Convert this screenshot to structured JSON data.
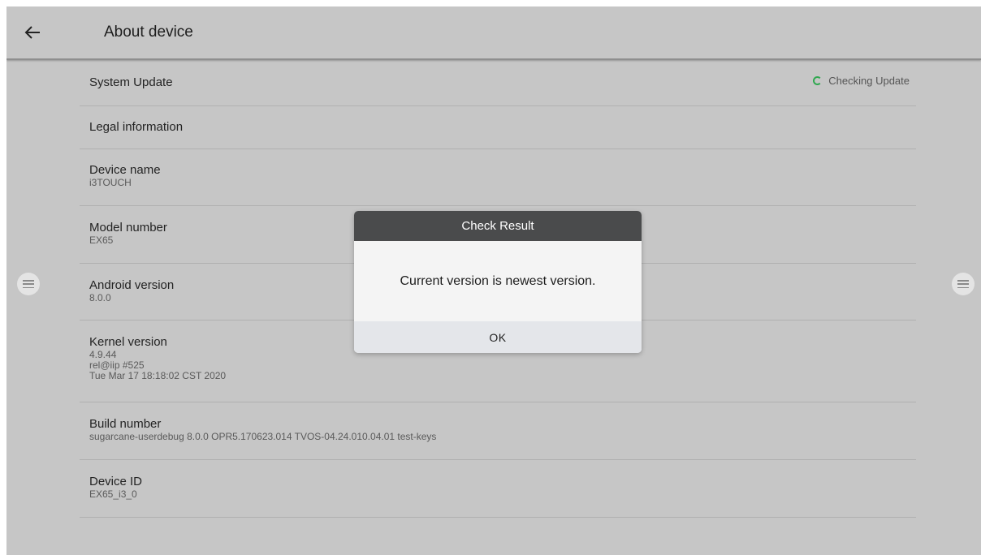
{
  "appbar": {
    "title": "About device",
    "back_icon": "arrow-left-icon"
  },
  "list": {
    "system_update": {
      "title": "System Update",
      "status": "Checking Update",
      "status_color": "#2fa84f"
    },
    "legal": {
      "title": "Legal information"
    },
    "device_name": {
      "title": "Device name",
      "value": "i3TOUCH"
    },
    "model_number": {
      "title": "Model number",
      "value": "EX65"
    },
    "android_version": {
      "title": "Android version",
      "value": "8.0.0"
    },
    "kernel_version": {
      "title": "Kernel version",
      "lines": [
        "4.9.44",
        "rel@iip #525",
        "Tue Mar 17 18:18:02 CST 2020"
      ]
    },
    "build_number": {
      "title": "Build number",
      "value": "sugarcane-userdebug 8.0.0 OPR5.170623.014 TVOS-04.24.010.04.01 test-keys"
    },
    "device_id": {
      "title": "Device ID",
      "value": "EX65_i3_0"
    }
  },
  "side_buttons": {
    "icon": "menu-icon"
  },
  "dialog": {
    "title": "Check Result",
    "message": "Current version is newest version.",
    "ok_label": "OK"
  }
}
